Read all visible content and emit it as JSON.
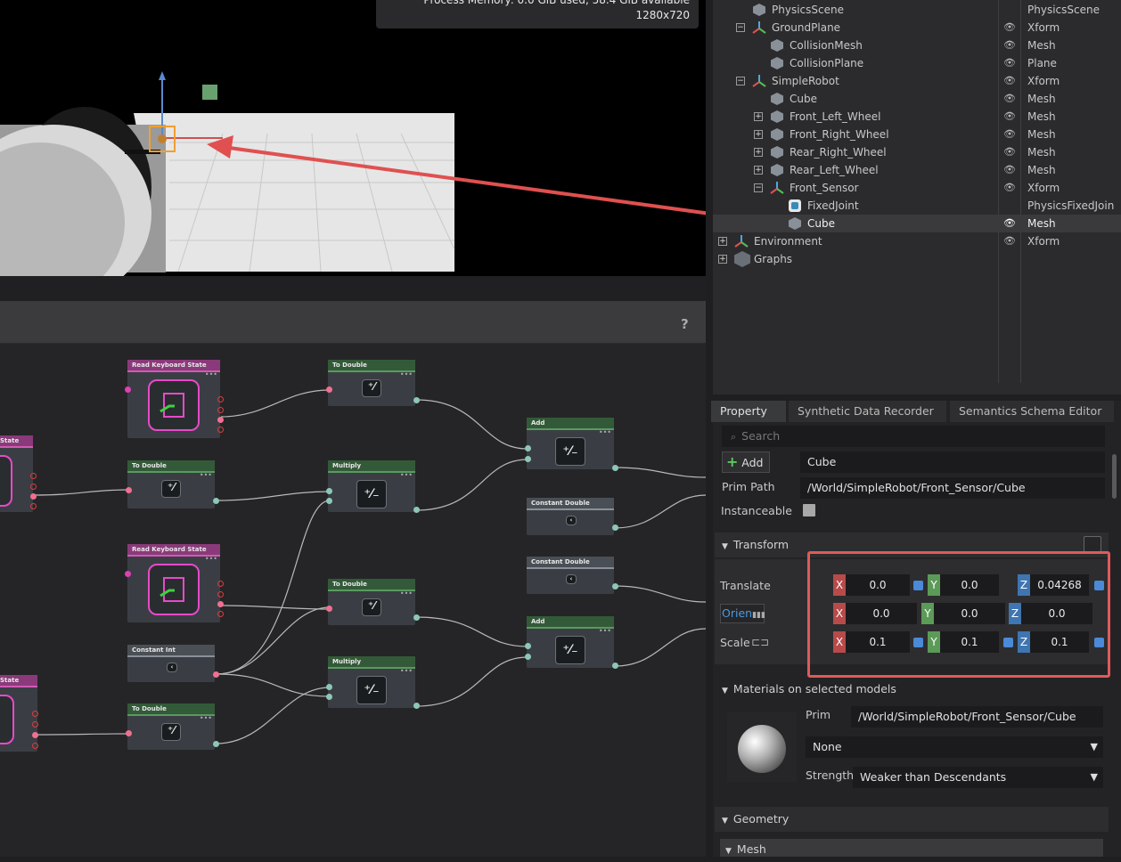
{
  "viewport": {
    "info_line1": "Process Memory: 0.0 GiB used, 58.4 GiB available",
    "resolution": "1280x720"
  },
  "graph": {
    "help": "?",
    "nodes": {
      "state_left_top": "State",
      "state_left_bottom": "State",
      "rks1": "Read Keyboard State",
      "rks2": "Read Keyboard State",
      "td1": "To Double",
      "td2": "To Double",
      "td3": "To Double",
      "td4": "To Double",
      "ci": "Constant Int",
      "mul1": "Multiply",
      "mul2": "Multiply",
      "add1": "Add",
      "add2": "Add",
      "cd1": "Constant Double",
      "cd2": "Constant Double"
    }
  },
  "stage": {
    "rows": [
      {
        "name": "PhysicsScene",
        "type": "PhysicsScene"
      },
      {
        "name": "GroundPlane",
        "type": "Xform"
      },
      {
        "name": "CollisionMesh",
        "type": "Mesh"
      },
      {
        "name": "CollisionPlane",
        "type": "Plane"
      },
      {
        "name": "SimpleRobot",
        "type": "Xform"
      },
      {
        "name": "Cube",
        "type": "Mesh"
      },
      {
        "name": "Front_Left_Wheel",
        "type": "Mesh"
      },
      {
        "name": "Front_Right_Wheel",
        "type": "Mesh"
      },
      {
        "name": "Rear_Right_Wheel",
        "type": "Mesh"
      },
      {
        "name": "Rear_Left_Wheel",
        "type": "Mesh"
      },
      {
        "name": "Front_Sensor",
        "type": "Xform"
      },
      {
        "name": "FixedJoint",
        "type": "PhysicsFixedJoin"
      },
      {
        "name": "Cube",
        "type": "Mesh"
      },
      {
        "name": "Environment",
        "type": "Xform"
      },
      {
        "name": "Graphs",
        "type": ""
      }
    ]
  },
  "property": {
    "tabs": [
      "Property",
      "Synthetic Data Recorder",
      "Semantics Schema Editor"
    ],
    "search_placeholder": "Search",
    "add_label": "Add",
    "name_value": "Cube",
    "prim_path_label": "Prim Path",
    "prim_path_value": "/World/SimpleRobot/Front_Sensor/Cube",
    "instanceable_label": "Instanceable",
    "transform_label": "Transform",
    "translate_label": "Translate",
    "orient_label": "Orien",
    "scale_label": "Scale",
    "translate": {
      "x": "0.0",
      "y": "0.0",
      "z": "0.04268"
    },
    "orient": {
      "x": "0.0",
      "y": "0.0",
      "z": "0.0"
    },
    "scale": {
      "x": "0.1",
      "y": "0.1",
      "z": "0.1"
    },
    "materials_label": "Materials on selected models",
    "prim_label": "Prim",
    "prim_value": "/World/SimpleRobot/Front_Sensor/Cube",
    "material_value": "None",
    "strength_label": "Strength",
    "strength_value": "Weaker than Descendants",
    "geometry_label": "Geometry",
    "mesh_label": "Mesh"
  },
  "colors": {
    "highlight": "#e05a5a",
    "accent": "#4a8ad8"
  }
}
